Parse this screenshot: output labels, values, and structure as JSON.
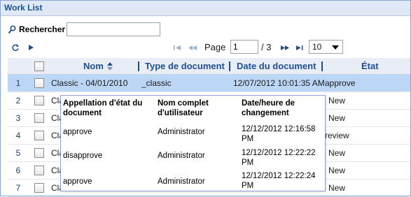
{
  "window": {
    "title": "Work List"
  },
  "search": {
    "label": "Rechercher",
    "value": ""
  },
  "pager": {
    "page_label": "Page",
    "page_value": "1",
    "total": "/ 3",
    "page_size": "10"
  },
  "table": {
    "headers": {
      "name": "Nom",
      "doc_type": "Type de document",
      "doc_date": "Date du document",
      "state": "État"
    },
    "rows": [
      {
        "num": "1",
        "name": "Classic - 04/01/2010",
        "type": "_classic",
        "date": "12/07/2012 10:01:35 AM",
        "state": "approve",
        "selected": true
      },
      {
        "num": "2",
        "name": "Cla",
        "type": "",
        "date": "",
        "state": "New",
        "selected": false
      },
      {
        "num": "3",
        "name": "Cla",
        "type": "",
        "date": "",
        "state": "New",
        "selected": false
      },
      {
        "num": "4",
        "name": "Cla",
        "type": "",
        "date": "",
        "state": "review",
        "selected": false
      },
      {
        "num": "5",
        "name": "Cla",
        "type": "",
        "date": "",
        "state": "New",
        "selected": false
      },
      {
        "num": "6",
        "name": "Cla",
        "type": "",
        "date": "",
        "state": "New",
        "selected": false
      },
      {
        "num": "7",
        "name": "Cla",
        "type": "",
        "date": "",
        "state": "New",
        "selected": false
      }
    ]
  },
  "history_popup": {
    "headers": {
      "state_name": [
        "Appellation d'état du",
        "document"
      ],
      "user": [
        "Nom complet",
        "d'utilisateur"
      ],
      "date": [
        "Date/heure de",
        "changement"
      ]
    },
    "rows": [
      {
        "state": "approve",
        "user": "Administrator",
        "date": [
          "12/12/2012 12:16:58",
          "PM"
        ]
      },
      {
        "state": "disapprove",
        "user": "Administrator",
        "date": [
          "12/12/2012 12:22:22",
          "PM"
        ]
      },
      {
        "state": "approve",
        "user": "Administrator",
        "date": [
          "12/12/2012 12:22:24",
          "PM"
        ]
      }
    ]
  },
  "colors": {
    "accent": "#1f4f93",
    "selected_row": "#bcd6f5",
    "header_bg": "#dfe9f6"
  }
}
